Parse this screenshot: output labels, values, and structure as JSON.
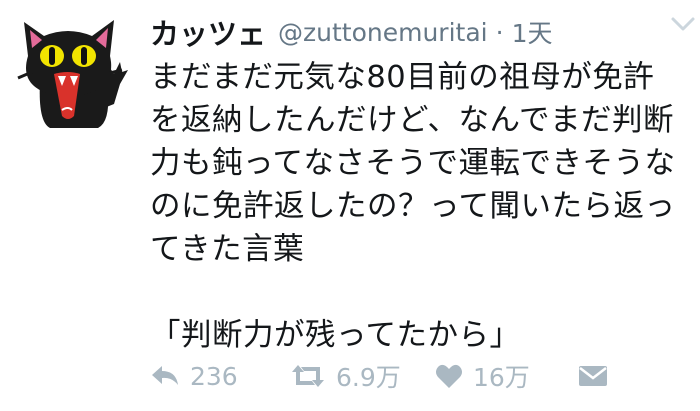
{
  "user": {
    "display_name": "カッツェ",
    "handle": "@zuttonemuritai",
    "separator": "·",
    "time": "1天"
  },
  "tweet": {
    "lines": [
      "まだまだ元気な80目前の祖母が免許",
      "を返納したんだけど、なんでまだ判断",
      "力も鈍ってなさそうで運転できそうな",
      "のに免許返したの？って聞いたら返っ",
      "てきた言葉",
      "",
      "「判断力が残ってたから」"
    ]
  },
  "actions": {
    "reply_count": "236",
    "retweet_count": "6.9万",
    "like_count": "16万"
  },
  "icons": {
    "avatar": "black-cat-avatar",
    "menu": "chevron-down-icon",
    "reply": "reply-icon",
    "retweet": "retweet-icon",
    "like": "heart-icon",
    "dm": "envelope-icon"
  },
  "colors": {
    "text": "#14171a",
    "secondary": "#657786",
    "icon": "#aab8c2",
    "chevron": "#ccd6dd"
  }
}
